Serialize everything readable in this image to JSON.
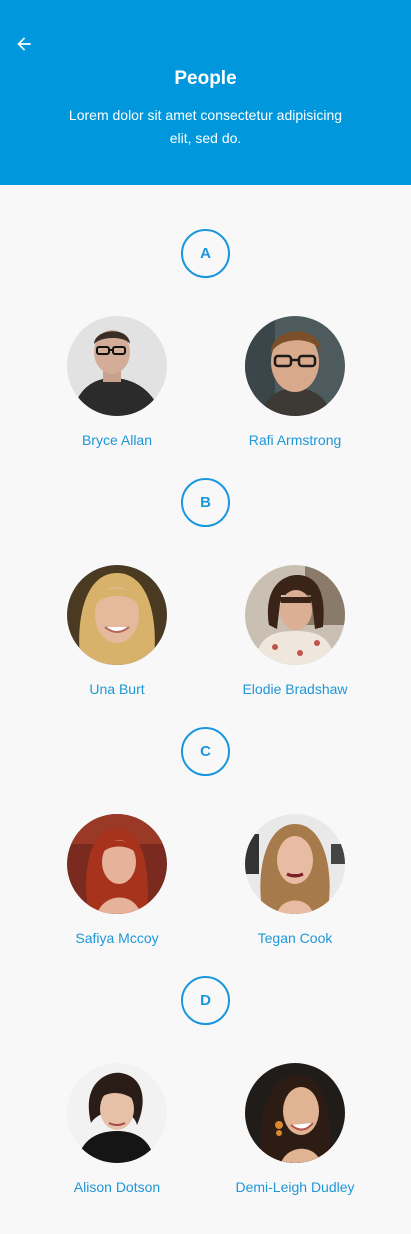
{
  "header": {
    "title": "People",
    "subtitle": "Lorem dolor sit amet consectetur adipisicing elit, sed do.",
    "back_icon": "arrow-left-icon"
  },
  "colors": {
    "header_bg": "#0097dc",
    "accent": "#1a96dd",
    "page_bg": "#f8f8f9"
  },
  "sections": [
    {
      "letter": "A",
      "people": [
        {
          "name": "Bryce Allan",
          "avatar": "avatar-photo"
        },
        {
          "name": "Rafi Armstrong",
          "avatar": "avatar-photo"
        }
      ]
    },
    {
      "letter": "B",
      "people": [
        {
          "name": "Una Burt",
          "avatar": "avatar-photo"
        },
        {
          "name": "Elodie Bradshaw",
          "avatar": "avatar-photo"
        }
      ]
    },
    {
      "letter": "C",
      "people": [
        {
          "name": "Safiya Mccoy",
          "avatar": "avatar-photo"
        },
        {
          "name": "Tegan Cook",
          "avatar": "avatar-photo"
        }
      ]
    },
    {
      "letter": "D",
      "people": [
        {
          "name": "Alison Dotson",
          "avatar": "avatar-photo"
        },
        {
          "name": "Demi-Leigh Dudley",
          "avatar": "avatar-photo"
        }
      ]
    }
  ]
}
